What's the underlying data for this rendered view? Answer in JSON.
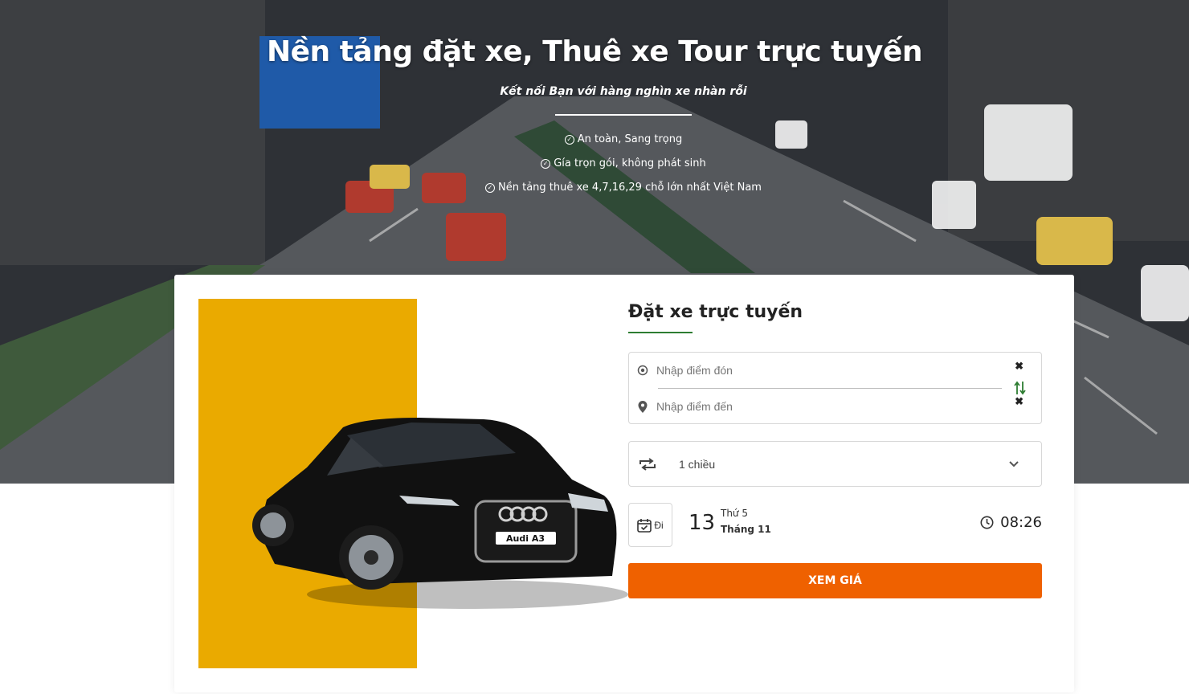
{
  "hero": {
    "title": "Nền tảng đặt xe, Thuê xe Tour trực tuyến",
    "subtitle": "Kết nối Bạn với hàng nghìn xe nhàn rỗi",
    "features": [
      "An toàn, Sang trọng",
      "Gía trọn gói, không phát sinh",
      "Nền tảng thuê xe 4,7,16,29 chỗ lớn nhất Việt Nam"
    ]
  },
  "booking": {
    "title": "Đặt xe trực tuyến",
    "pickup_placeholder": "Nhập điểm đón",
    "dropoff_placeholder": "Nhập điểm đến",
    "trip_type": "1 chiều",
    "date_label": "Đi",
    "day": "13",
    "weekday": "Thứ 5",
    "month": "Tháng 11",
    "time": "08:26",
    "submit_label": "XEM GIÁ"
  },
  "car_plate": "Audi A3",
  "colors": {
    "accent": "#ef6100",
    "brand_green": "#2e7d32",
    "yellow_block": "#eaaa00"
  }
}
